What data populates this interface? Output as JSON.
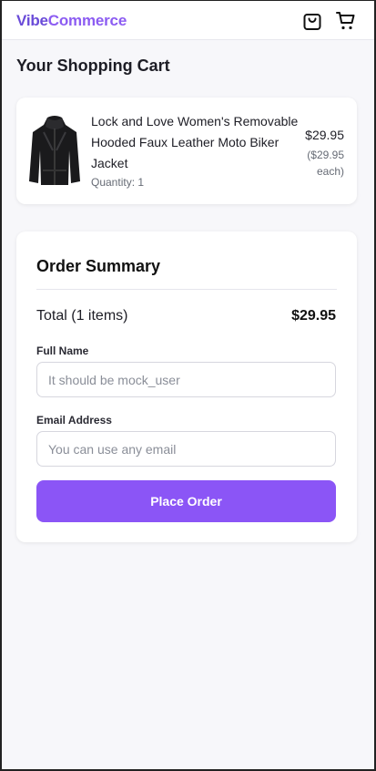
{
  "header": {
    "brand_part1": "Vibe",
    "brand_part2": "Commerce",
    "icons": [
      "shopping-bag-icon",
      "cart-icon"
    ]
  },
  "page_title": "Your Shopping Cart",
  "cart": {
    "items": [
      {
        "name": "Lock and Love Women's Removable Hooded Faux Leather Moto Biker Jacket",
        "quantity_text": "Quantity: 1",
        "price": "$29.95",
        "each_price": "($29.95 each)",
        "image_icon": "jacket-image"
      }
    ]
  },
  "summary": {
    "title": "Order Summary",
    "total_label": "Total (1 items)",
    "total_value": "$29.95",
    "full_name_label": "Full Name",
    "full_name_placeholder": "It should be mock_user",
    "full_name_value": "",
    "email_label": "Email Address",
    "email_placeholder": "You can use any email",
    "email_value": "",
    "place_order_label": "Place Order"
  },
  "colors": {
    "brand_dark": "#6a4bd8",
    "brand_light": "#8c5cf2",
    "button": "#8b55f6",
    "page_bg": "#f7f7fa"
  }
}
